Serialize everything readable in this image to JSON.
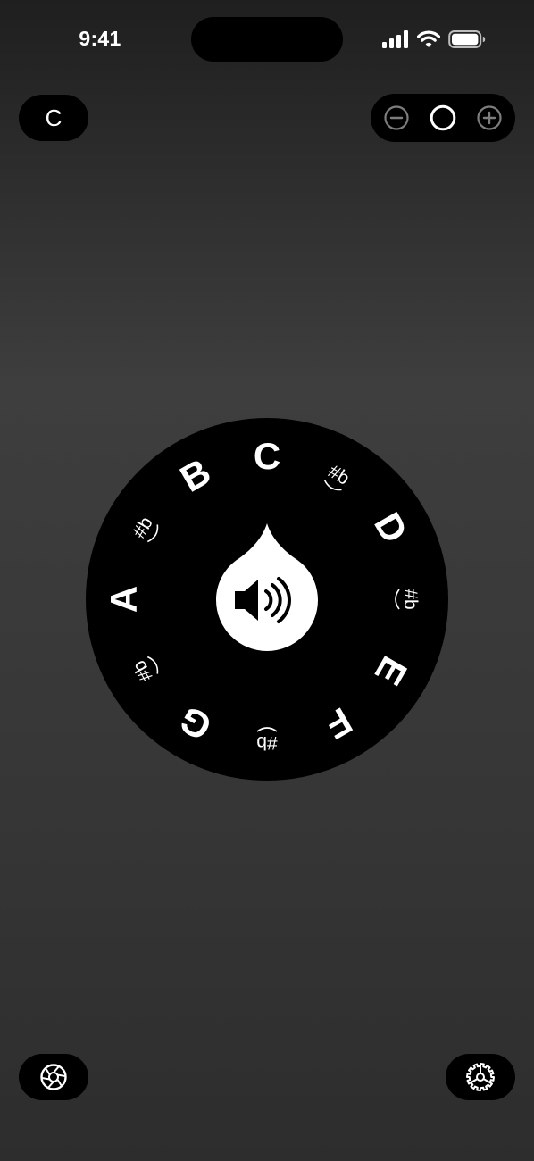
{
  "status_bar": {
    "time": "9:41"
  },
  "key_selector": {
    "label": "C"
  },
  "octave_control": {
    "decrease_icon": "minus-circle-icon",
    "indicator_icon": "circle-icon",
    "increase_icon": "plus-circle-icon"
  },
  "pitch_pipe": {
    "center_icon": "speaker-wave-icon",
    "notes": [
      {
        "label": "C",
        "kind": "natural"
      },
      {
        "label": "#b",
        "kind": "accidental"
      },
      {
        "label": "D",
        "kind": "natural"
      },
      {
        "label": "#b",
        "kind": "accidental"
      },
      {
        "label": "E",
        "kind": "natural"
      },
      {
        "label": "F",
        "kind": "natural"
      },
      {
        "label": "#b",
        "kind": "accidental"
      },
      {
        "label": "G",
        "kind": "natural"
      },
      {
        "label": "#b",
        "kind": "accidental"
      },
      {
        "label": "A",
        "kind": "natural"
      },
      {
        "label": "#b",
        "kind": "accidental"
      },
      {
        "label": "B",
        "kind": "natural"
      }
    ]
  },
  "bottom_bar": {
    "left_icon": "aperture-icon",
    "right_icon": "gear-icon"
  },
  "colors": {
    "background_top": "#1f1f1f",
    "background_mid": "#3e3e3e",
    "panel": "#000000",
    "foreground": "#ffffff",
    "muted_icon": "#8a8a8a"
  }
}
